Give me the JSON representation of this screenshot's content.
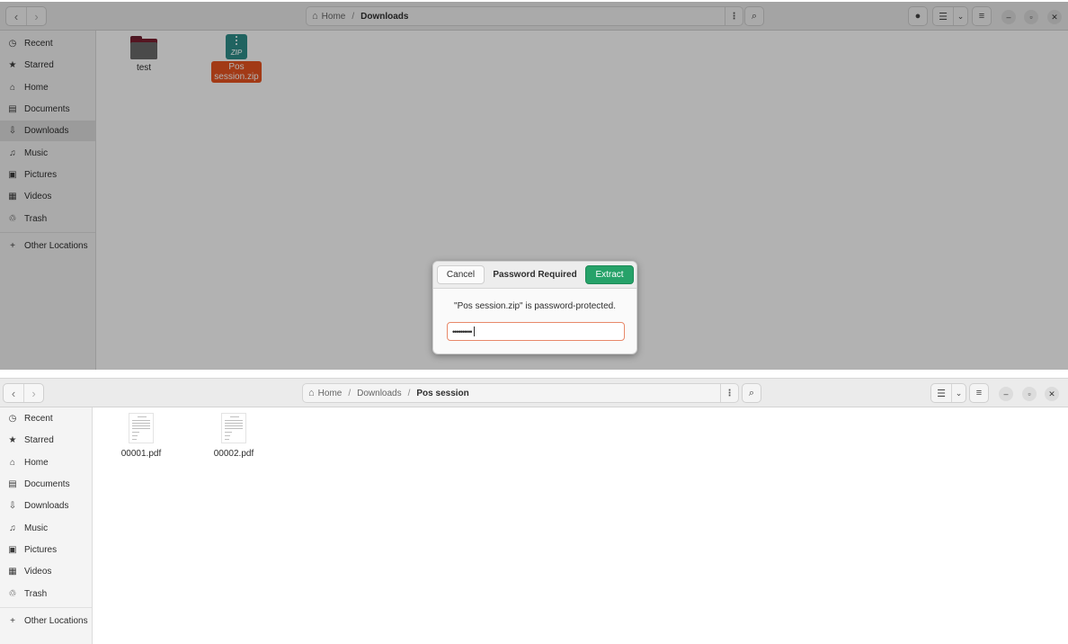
{
  "window1": {
    "breadcrumb": {
      "home": "Home",
      "current": "Downloads"
    },
    "sidebar": [
      {
        "icon": "clock-icon",
        "glyph": "◷",
        "label": "Recent"
      },
      {
        "icon": "star-icon",
        "glyph": "★",
        "label": "Starred"
      },
      {
        "icon": "home-icon",
        "glyph": "⌂",
        "label": "Home"
      },
      {
        "icon": "document-icon",
        "glyph": "▤",
        "label": "Documents"
      },
      {
        "icon": "download-icon",
        "glyph": "⇩",
        "label": "Downloads",
        "active": true
      },
      {
        "icon": "music-icon",
        "glyph": "♫",
        "label": "Music"
      },
      {
        "icon": "picture-icon",
        "glyph": "▣",
        "label": "Pictures"
      },
      {
        "icon": "video-icon",
        "glyph": "▦",
        "label": "Videos"
      },
      {
        "icon": "trash-icon",
        "glyph": "♲",
        "label": "Trash"
      },
      {
        "icon": "plus-icon",
        "glyph": "+",
        "label": "Other Locations"
      }
    ],
    "files": [
      {
        "type": "folder",
        "name": "test"
      },
      {
        "type": "zip",
        "name_line1": "Pos",
        "name_line2": "session.zip",
        "selected": true
      }
    ],
    "dialog": {
      "cancel": "Cancel",
      "title": "Password Required",
      "extract": "Extract",
      "message": "\"Pos session.zip\" is password-protected.",
      "password_mask": "••••••••••"
    }
  },
  "window2": {
    "breadcrumb": {
      "home": "Home",
      "middle": "Downloads",
      "current": "Pos session"
    },
    "sidebar": [
      {
        "icon": "clock-icon",
        "glyph": "◷",
        "label": "Recent"
      },
      {
        "icon": "star-icon",
        "glyph": "★",
        "label": "Starred"
      },
      {
        "icon": "home-icon",
        "glyph": "⌂",
        "label": "Home"
      },
      {
        "icon": "document-icon",
        "glyph": "▤",
        "label": "Documents"
      },
      {
        "icon": "download-icon",
        "glyph": "⇩",
        "label": "Downloads"
      },
      {
        "icon": "music-icon",
        "glyph": "♫",
        "label": "Music"
      },
      {
        "icon": "picture-icon",
        "glyph": "▣",
        "label": "Pictures"
      },
      {
        "icon": "video-icon",
        "glyph": "▦",
        "label": "Videos"
      },
      {
        "icon": "trash-icon",
        "glyph": "♲",
        "label": "Trash"
      },
      {
        "icon": "plus-icon",
        "glyph": "+",
        "label": "Other Locations"
      }
    ],
    "files": [
      {
        "type": "pdf",
        "name": "00001.pdf"
      },
      {
        "type": "pdf",
        "name": "00002.pdf"
      }
    ]
  },
  "colors": {
    "accent_selection": "#e95420",
    "extract_button": "#26a269",
    "zip_icon": "#2f8f8a",
    "folder_front": "#6b6b6b",
    "folder_back": "#7a1f30"
  }
}
